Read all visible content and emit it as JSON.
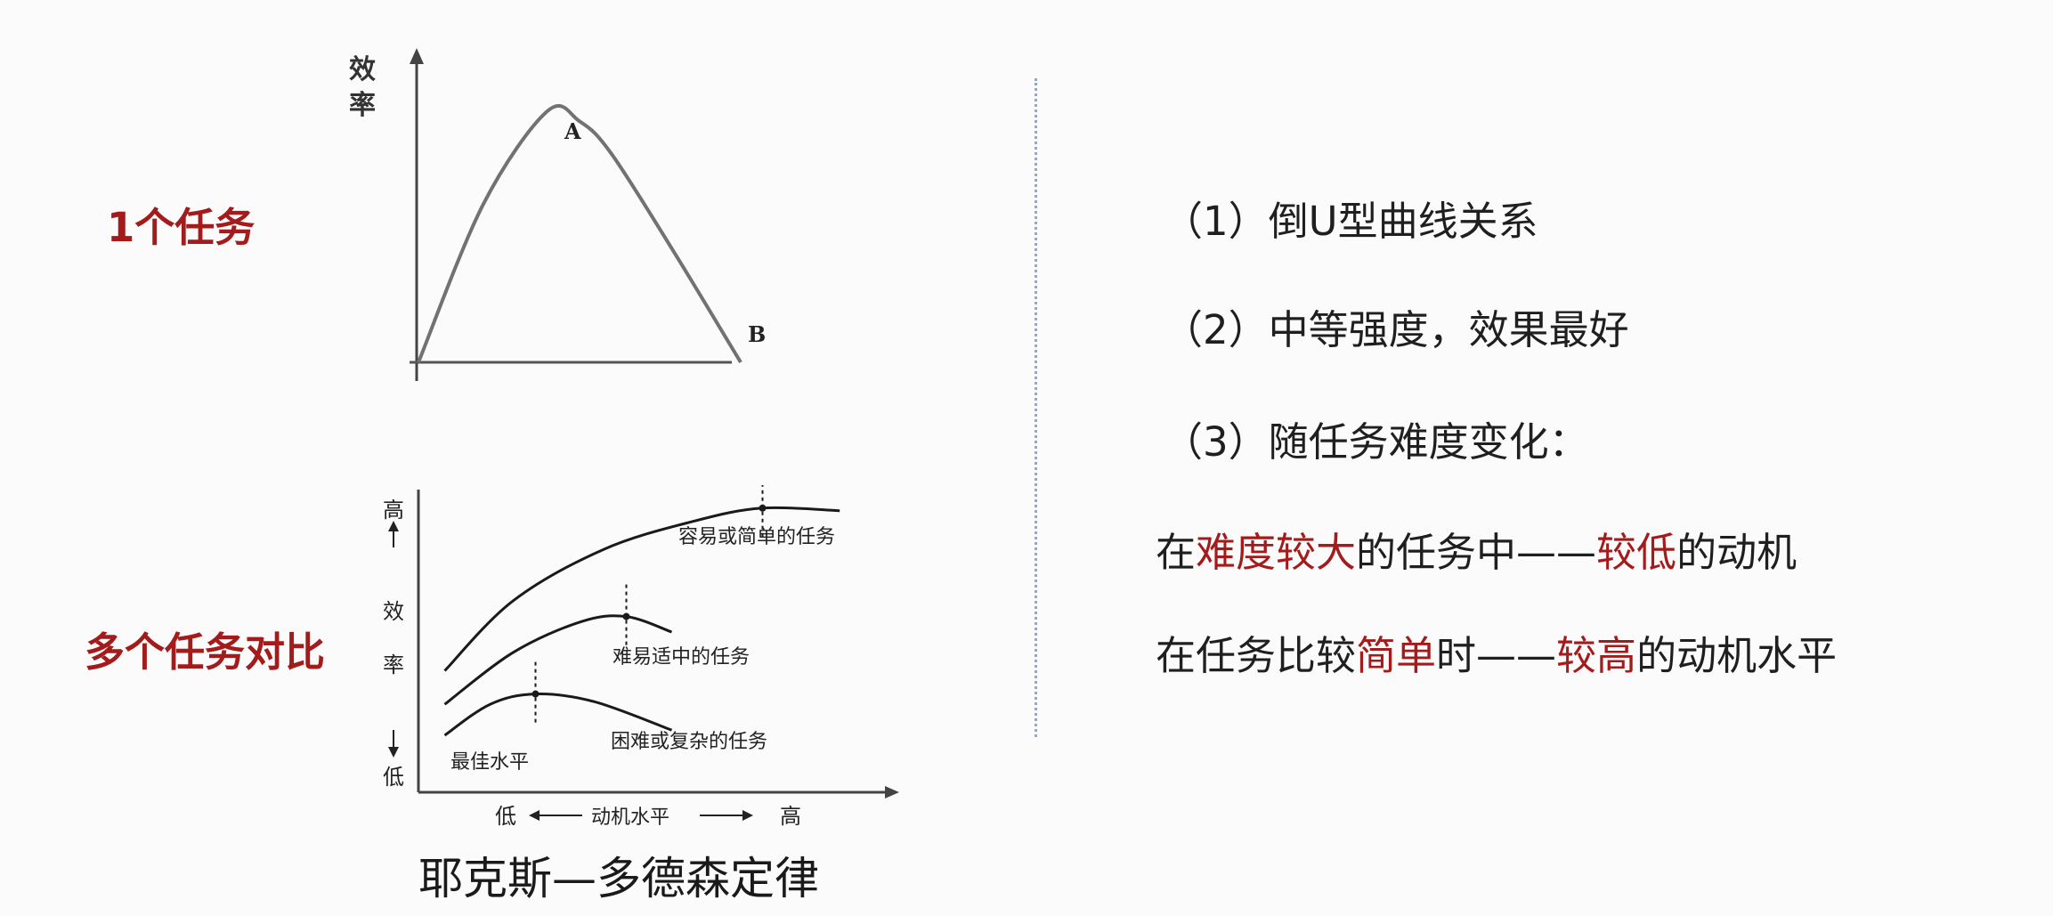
{
  "left": {
    "label_one_task": "1个任务",
    "label_multi_task": "多个任务对比",
    "caption": "耶克斯—多德森定律"
  },
  "chart_data": [
    {
      "type": "line",
      "ylabel": "效率",
      "xlabel": "",
      "annotations": [
        "A",
        "B"
      ],
      "series": [
        {
          "x": [
            0,
            0.2,
            0.4,
            0.5,
            0.6,
            0.8,
            1.0
          ],
          "values": [
            0,
            0.62,
            0.99,
            0.95,
            0.82,
            0.42,
            0.0
          ]
        }
      ]
    },
    {
      "type": "line",
      "ylabel": "效率",
      "y_tick_labels": [
        "高",
        "低"
      ],
      "xlabel": "动机水平",
      "x_tick_labels": [
        "低",
        "高"
      ],
      "optimum_label": "最佳水平",
      "series": [
        {
          "name": "容易或简单的任务",
          "x": [
            0.05,
            0.2,
            0.4,
            0.6,
            0.75,
            0.92
          ],
          "values": [
            0.35,
            0.62,
            0.82,
            0.93,
            0.98,
            0.97
          ],
          "optimum_x": 0.75
        },
        {
          "name": "难易适中的任务",
          "x": [
            0.05,
            0.2,
            0.35,
            0.45,
            0.55
          ],
          "values": [
            0.22,
            0.42,
            0.54,
            0.56,
            0.5
          ],
          "optimum_x": 0.45
        },
        {
          "name": "困难或复杂的任务",
          "x": [
            0.05,
            0.15,
            0.25,
            0.38,
            0.55
          ],
          "values": [
            0.1,
            0.22,
            0.26,
            0.23,
            0.12
          ],
          "optimum_x": 0.25
        }
      ]
    }
  ],
  "right": {
    "p1": "（1）倒U型曲线关系",
    "p2": "（2）中等强度，效果最好",
    "p3": "（3）随任务难度变化：",
    "line4": {
      "a": "在",
      "b": "难度较大",
      "c": "的任务中——",
      "d": "较低",
      "e": "的动机"
    },
    "line5": {
      "a": "在任务比较",
      "b": "简单",
      "c": "时——",
      "d": "较高",
      "e": "的动机水平"
    }
  },
  "colors": {
    "accent": "#a41b1b",
    "divider": "#9aa2cf",
    "curve": "#707070",
    "ink": "#1f1f1f"
  }
}
